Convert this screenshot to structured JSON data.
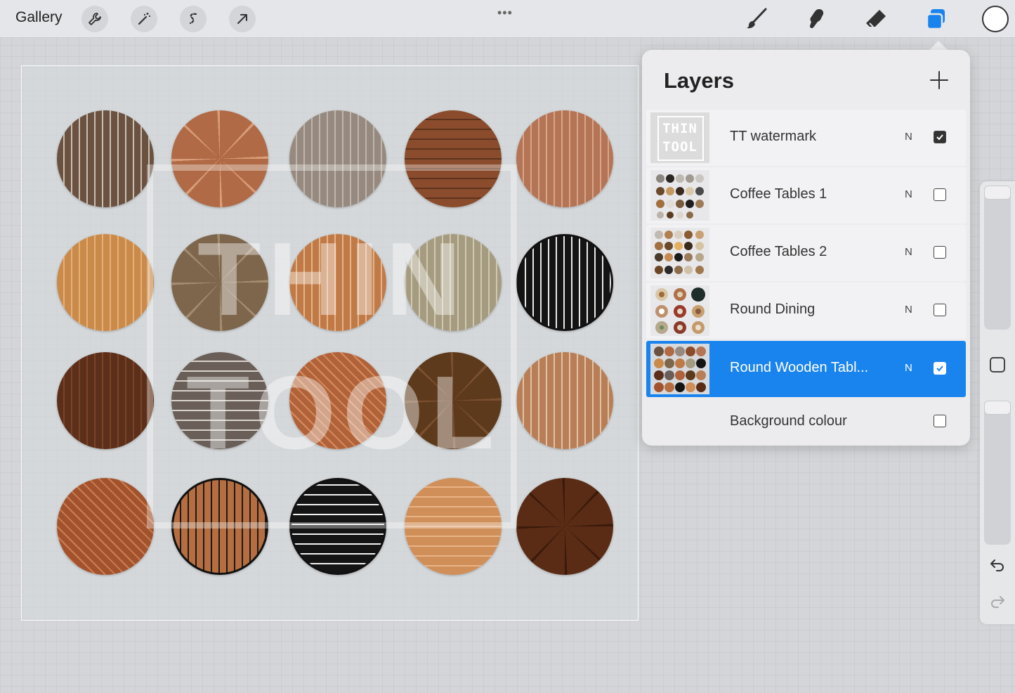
{
  "toolbar": {
    "gallery_label": "Gallery",
    "more_label": "•••",
    "left_tools": [
      "wrench-icon",
      "magic-wand-icon",
      "selection-icon",
      "transform-arrow-icon"
    ],
    "right_tools": [
      "brush-icon",
      "smudge-icon",
      "eraser-icon",
      "layers-icon"
    ],
    "accent": "#1a84ee",
    "current_color": "#ffffff"
  },
  "canvas": {
    "watermark_line1": "THIN",
    "watermark_line2": "TOOL",
    "tables": [
      {
        "color": "#6a5140",
        "stripe": "#c9bfb4"
      },
      {
        "color": "#b06a46",
        "stripe": "#d99c78"
      },
      {
        "color": "#968a80",
        "stripe": "#bfb5ab"
      },
      {
        "color": "#8a4c2c",
        "stripe": "#5e331e"
      },
      {
        "color": "#b47456",
        "stripe": "#d9a588"
      },
      {
        "color": "#c98a4a",
        "stripe": "#e6b07a"
      },
      {
        "color": "#7d664c",
        "stripe": "#a28b6e"
      },
      {
        "color": "#c07a48",
        "stripe": "#e6b48a"
      },
      {
        "color": "#a59b80",
        "stripe": "#d0c8b0"
      },
      {
        "color": "#141414",
        "stripe": "#e8e8e8"
      },
      {
        "color": "#5b2f1a",
        "stripe": "#7b4327"
      },
      {
        "color": "#695f58",
        "stripe": "#d8d2cc"
      },
      {
        "color": "#b0633a",
        "stripe": "#d98c5c"
      },
      {
        "color": "#5e3a1c",
        "stripe": "#7a5030"
      },
      {
        "color": "#b77e58",
        "stripe": "#e3c2a4"
      },
      {
        "color": "#a2532e",
        "stripe": "#cc7e52"
      },
      {
        "color": "#b66e40",
        "stripe": "#1a1a1a"
      },
      {
        "color": "#141414",
        "stripe": "#f0f0f0"
      },
      {
        "color": "#d08e58",
        "stripe": "#e9b486"
      },
      {
        "color": "#5a2c16",
        "stripe": "#3a1a0a"
      }
    ]
  },
  "layers": {
    "title": "Layers",
    "items": [
      {
        "name": "TT watermark",
        "blend": "N",
        "visible": true,
        "active": false,
        "thumb_text_1": "THIN",
        "thumb_text_2": "TOOL"
      },
      {
        "name": "Coffee Tables 1",
        "blend": "N",
        "visible": false,
        "active": false
      },
      {
        "name": "Coffee Tables 2",
        "blend": "N",
        "visible": false,
        "active": false
      },
      {
        "name": "Round Dining",
        "blend": "N",
        "visible": false,
        "active": false
      },
      {
        "name": "Round Wooden Tabl...",
        "blend": "N",
        "visible": true,
        "active": true
      }
    ],
    "background": {
      "name": "Background colour",
      "visible": false
    }
  },
  "sidebar": {
    "undo_icon": "undo-icon",
    "redo_icon": "redo-icon"
  }
}
